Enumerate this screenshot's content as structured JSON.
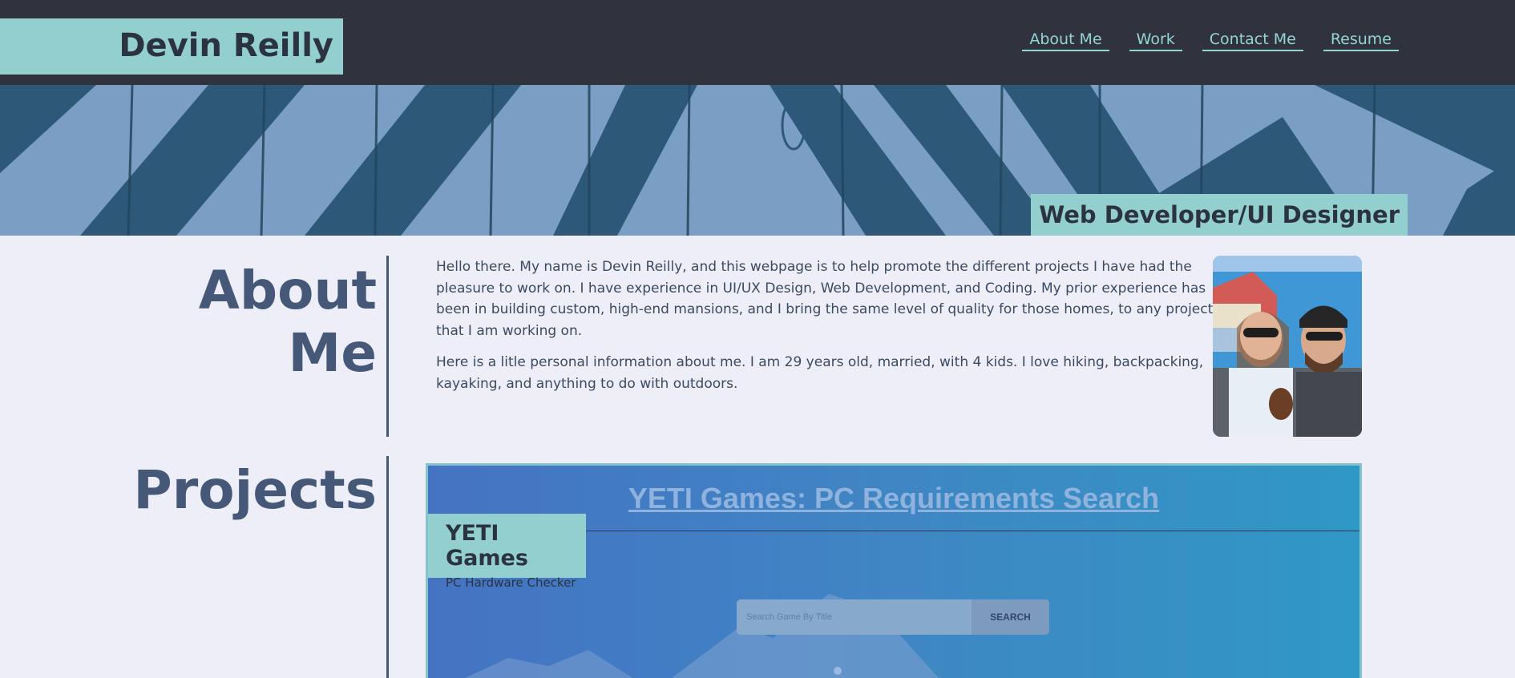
{
  "header": {
    "brand": "Devin Reilly",
    "nav": [
      "About Me",
      "Work",
      "Contact Me",
      "Resume"
    ]
  },
  "banner": {
    "tagline": "Web Developer/UI Designer"
  },
  "about": {
    "title_line1": "About",
    "title_line2": "Me",
    "paragraphs": [
      "Hello there. My name is Devin Reilly, and this webpage is to help promote the different projects I have had the pleasure to work on. I have experience in UI/UX Design, Web Development, and Coding. My prior experience has been in building custom, high-end mansions, and I bring the same level of quality for those homes, to any project that I am working on.",
      "Here is a litle personal information about me. I am 29 years old, married, with 4 kids. I love hiking, backpacking, kayaking, and anything to do with outdoors."
    ]
  },
  "projects": {
    "title": "Projects",
    "card": {
      "heading": "YETI Games: PC Requirements Search",
      "label_title": "YETI Games",
      "label_subtitle": "PC Hardware Checker",
      "search_placeholder": "Search Game By Title",
      "search_button": "SEARCH"
    }
  },
  "colors": {
    "header_bg": "#30333d",
    "accent_teal": "#93cfcf",
    "page_bg": "#edeef7",
    "heading_blue": "#455878",
    "banner_dark": "#2e5877",
    "banner_light": "#7b9fc4"
  }
}
